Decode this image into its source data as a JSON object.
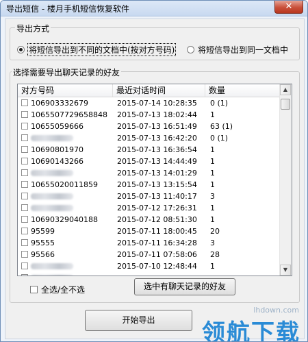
{
  "window": {
    "title": "导出短信 - 楼月手机短信恢复软件",
    "close_label": "✕"
  },
  "export_mode": {
    "legend": "导出方式",
    "options": [
      {
        "label": "将短信导出到不同的文档中(按对方号码)",
        "selected": true
      },
      {
        "label": "将短信导出到同一文档中",
        "selected": false
      }
    ]
  },
  "friends": {
    "legend": "选择需要导出聊天记录的好友",
    "columns": [
      "对方号码",
      "最近对话时间",
      "数量"
    ],
    "rows": [
      {
        "number": "106903332679",
        "time": "2015-07-14 10:28:35",
        "count": "0 (1)",
        "masked": false
      },
      {
        "number": "1065507729658848",
        "time": "2015-07-13 18:02:44",
        "count": "1",
        "masked": false
      },
      {
        "number": "10655059666",
        "time": "2015-07-13 16:51:49",
        "count": "63 (1)",
        "masked": false
      },
      {
        "number": "",
        "time": "2015-07-13 16:42:20",
        "count": "0 (1)",
        "masked": true
      },
      {
        "number": "10690801970",
        "time": "2015-07-13 16:36:54",
        "count": "1",
        "masked": false
      },
      {
        "number": "10690143266",
        "time": "2015-07-13 14:44:49",
        "count": "1",
        "masked": false
      },
      {
        "number": "",
        "time": "2015-07-13 14:01:29",
        "count": "1",
        "masked": true
      },
      {
        "number": "10655020011859",
        "time": "2015-07-13 13:15:54",
        "count": "1",
        "masked": false
      },
      {
        "number": "",
        "time": "2015-07-13 11:40:17",
        "count": "3",
        "masked": true
      },
      {
        "number": "",
        "time": "2015-07-12 17:26:31",
        "count": "1",
        "masked": true
      },
      {
        "number": "10690329040188",
        "time": "2015-07-12 08:51:30",
        "count": "1",
        "masked": false
      },
      {
        "number": "95599",
        "time": "2015-07-11 18:00:45",
        "count": "20",
        "masked": false
      },
      {
        "number": "95555",
        "time": "2015-07-11 16:34:28",
        "count": "3",
        "masked": false
      },
      {
        "number": "95566",
        "time": "2015-07-11 07:58:06",
        "count": "28",
        "masked": false
      },
      {
        "number": "",
        "time": "2015-07-10 12:48:44",
        "count": "1",
        "masked": true
      },
      {
        "number": "",
        "time": "",
        "count": "",
        "masked": true
      }
    ]
  },
  "select_all_label": "全选/全不选",
  "select_with_chat_label": "选中有聊天记录的好友",
  "start_export_label": "开始导出",
  "watermark": {
    "url": "lhdown.com",
    "text": "领航下载"
  }
}
